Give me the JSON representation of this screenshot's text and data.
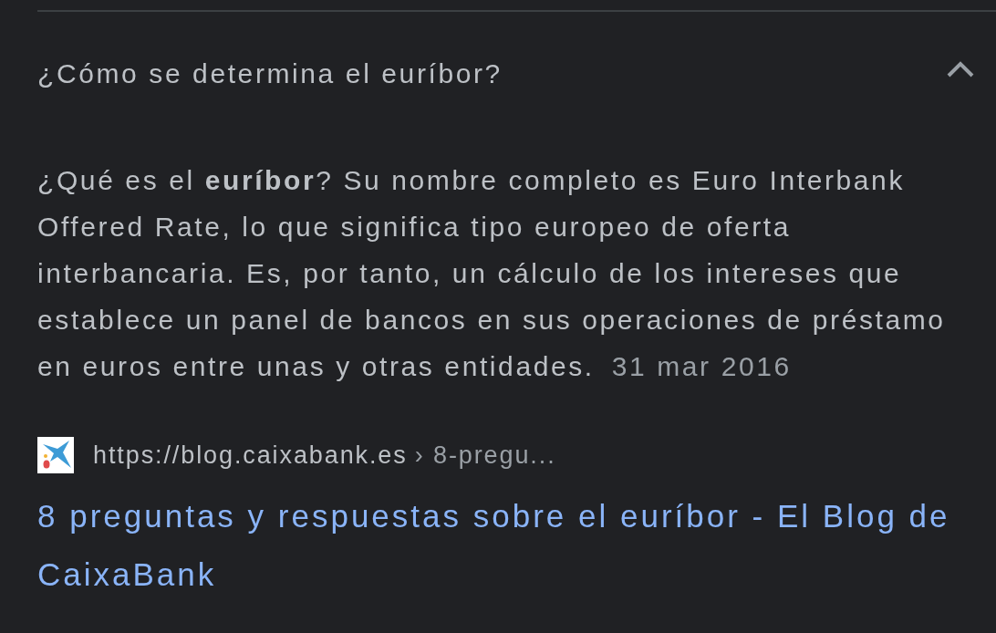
{
  "faq": {
    "question": "¿Cómo se determina el euríbor?",
    "expanded": true,
    "answer": "¿Qué es el **euríbor**? Su nombre completo es Euro Interbank Offered Rate, lo que significa tipo europeo de oferta interbancaria. Es, por tanto, un cálculo de los intereses que establece un panel de bancos en sus operaciones de préstamo en euros entre unas y otras entidades.",
    "date": "31 mar 2016",
    "source": {
      "url": "https://blog.caixabank.es",
      "path": "› 8-pregu..."
    },
    "title": "8 preguntas y respuestas sobre el euríbor - El Blog de CaixaBank"
  }
}
